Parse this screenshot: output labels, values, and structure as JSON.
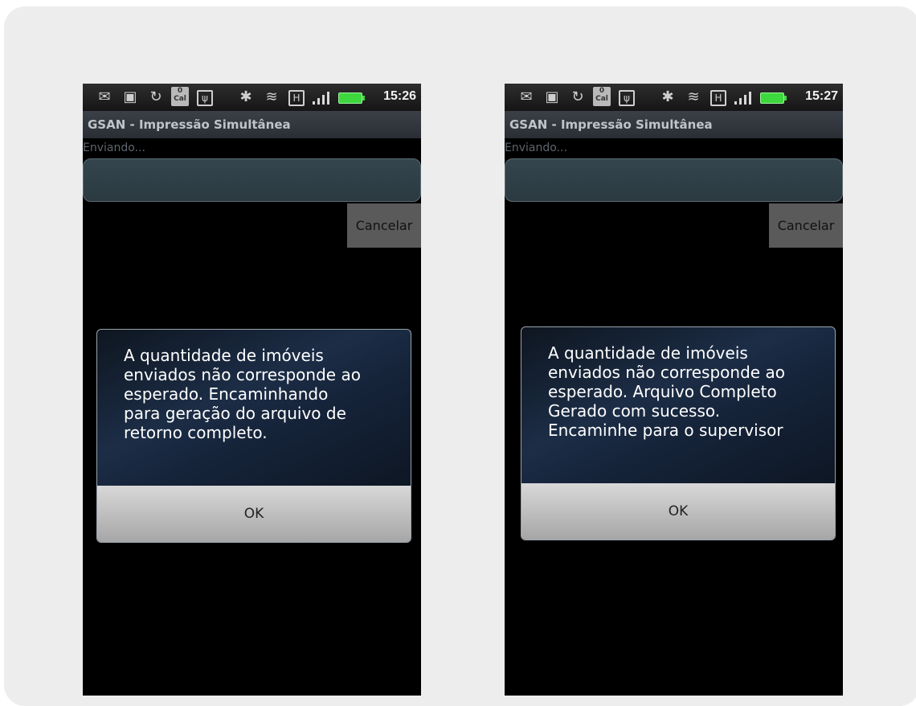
{
  "screens": [
    {
      "time": "15:26",
      "app_title": "GSAN - Impressão Simultânea",
      "status_text": "Enviando...",
      "cancel_label": "Cancelar",
      "dialog_message": "A quantidade de imóveis\nenviados não corresponde ao\nesperado. Encaminhando\npara geração do arquivo de\nretorno completo.",
      "ok_label": "OK",
      "calendar_badge": "0\nCal"
    },
    {
      "time": "15:27",
      "app_title": "GSAN - Impressão Simultânea",
      "status_text": "Enviando...",
      "cancel_label": "Cancelar",
      "dialog_message": "A quantidade de imóveis\nenviados não corresponde ao\nesperado. Arquivo Completo\nGerado com sucesso.\nEncaminhe para o supervisor",
      "ok_label": "OK",
      "calendar_badge": "0\nCal"
    }
  ],
  "colors": {
    "battery": "#3ed73e",
    "dialog_bg": "#1c2d46",
    "cancel_bg": "#5a5a5a"
  }
}
